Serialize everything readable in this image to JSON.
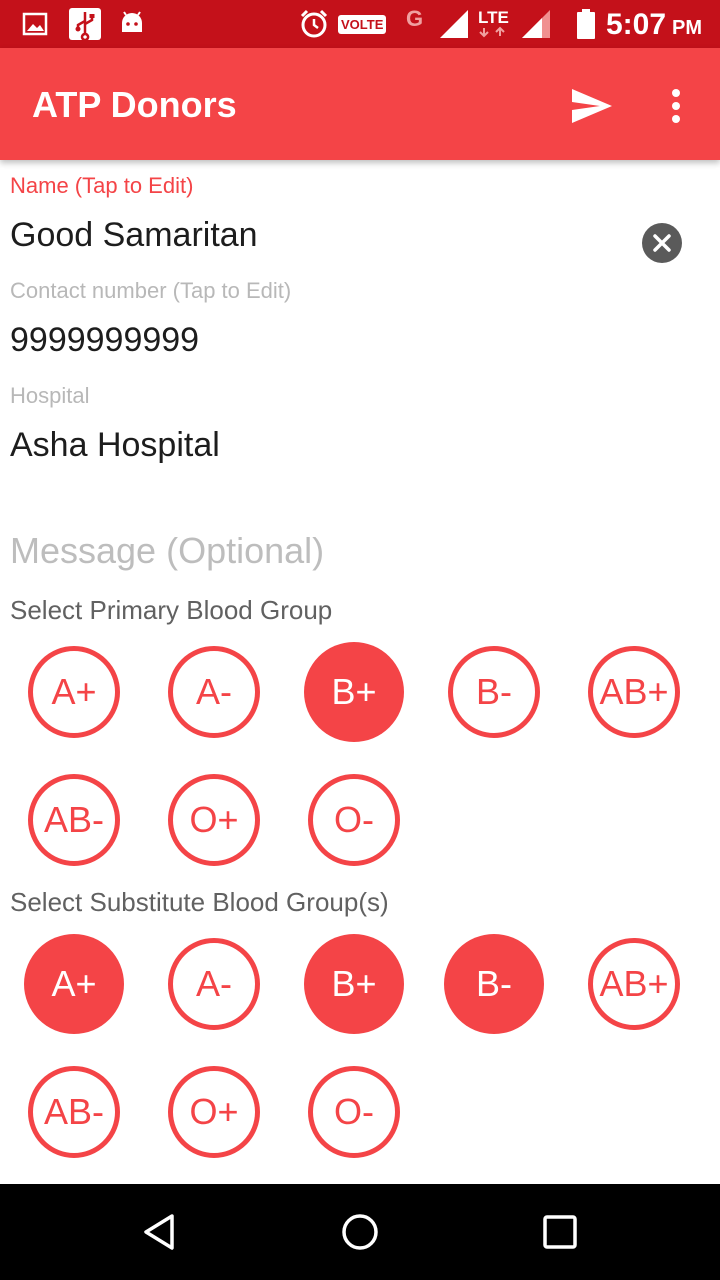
{
  "status_bar": {
    "volte": "VOLTE",
    "network_g": "G",
    "lte": "LTE",
    "time": "5:07",
    "ampm": "PM",
    "icons": [
      "image-icon",
      "usb-icon",
      "android-icon",
      "alarm-icon",
      "signal-icon",
      "battery-icon"
    ]
  },
  "app_bar": {
    "title": "ATP Donors",
    "actions": [
      "send-icon",
      "more-vert-icon"
    ]
  },
  "form": {
    "name_label": "Name (Tap to Edit)",
    "name_value": "Good Samaritan",
    "contact_label": "Contact number (Tap to Edit)",
    "contact_value": "9999999999",
    "hospital_label": "Hospital",
    "hospital_value": "Asha Hospital",
    "message_placeholder": "Message (Optional)"
  },
  "primary": {
    "title": "Select Primary Blood Group",
    "groups": [
      "A+",
      "A-",
      "B+",
      "B-",
      "AB+",
      "AB-",
      "O+",
      "O-"
    ],
    "selected": [
      "B+"
    ]
  },
  "substitute": {
    "title": "Select Substitute Blood Group(s)",
    "groups": [
      "A+",
      "A-",
      "B+",
      "B-",
      "AB+",
      "AB-",
      "O+",
      "O-"
    ],
    "selected": [
      "A+",
      "B+",
      "B-"
    ]
  },
  "colors": {
    "status_bar": "#c4111a",
    "accent": "#f44447",
    "nav_bar": "#000000"
  },
  "nav_bar": [
    "back-icon",
    "home-icon",
    "recents-icon"
  ]
}
